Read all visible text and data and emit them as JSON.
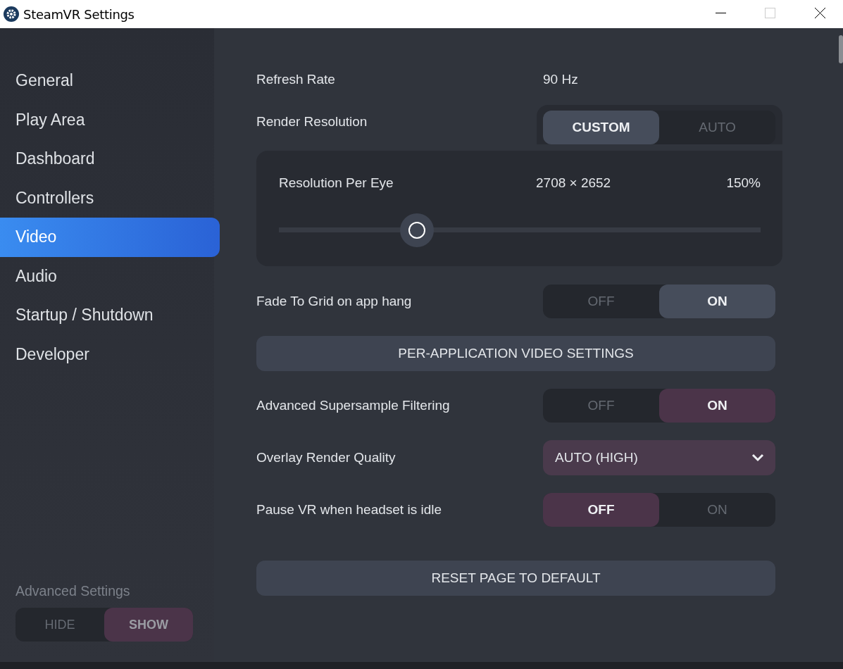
{
  "window": {
    "title": "SteamVR Settings"
  },
  "sidebar": {
    "items": [
      {
        "label": "General",
        "selected": false
      },
      {
        "label": "Play Area",
        "selected": false
      },
      {
        "label": "Dashboard",
        "selected": false
      },
      {
        "label": "Controllers",
        "selected": false
      },
      {
        "label": "Video",
        "selected": true
      },
      {
        "label": "Audio",
        "selected": false
      },
      {
        "label": "Startup / Shutdown",
        "selected": false
      },
      {
        "label": "Developer",
        "selected": false
      }
    ],
    "advanced": {
      "label": "Advanced Settings",
      "modified": true,
      "options": [
        {
          "label": "HIDE",
          "selected": false
        },
        {
          "label": "SHOW",
          "selected": true
        }
      ]
    }
  },
  "settings": [
    {
      "kind": "value",
      "label": "Refresh Rate",
      "value": "90 Hz"
    },
    {
      "kind": "segmented",
      "label": "Render Resolution",
      "modified": false,
      "options": [
        {
          "label": "CUSTOM",
          "selected": true
        },
        {
          "label": "AUTO",
          "selected": false
        }
      ]
    },
    {
      "kind": "slider",
      "label": "Resolution Per Eye",
      "resolution": "2708 × 2652",
      "percent": "150%",
      "level": 0.287
    },
    {
      "kind": "segmented",
      "label": "Fade To Grid on app hang",
      "modified": false,
      "options": [
        {
          "label": "OFF",
          "selected": false
        },
        {
          "label": "ON",
          "selected": true
        }
      ]
    },
    {
      "kind": "button",
      "label": "PER-APPLICATION VIDEO SETTINGS"
    },
    {
      "kind": "segmented",
      "label": "Advanced Supersample Filtering",
      "modified": true,
      "options": [
        {
          "label": "OFF",
          "selected": false
        },
        {
          "label": "ON",
          "selected": true
        }
      ]
    },
    {
      "kind": "dropdown",
      "label": "Overlay Render Quality",
      "modified": true,
      "value": "AUTO (HIGH)"
    },
    {
      "kind": "segmented",
      "label": "Pause VR when headset is idle",
      "modified": true,
      "options": [
        {
          "label": "OFF",
          "selected": true
        },
        {
          "label": "ON",
          "selected": false
        }
      ]
    }
  ],
  "footer_button": {
    "label": "RESET PAGE TO DEFAULT"
  }
}
